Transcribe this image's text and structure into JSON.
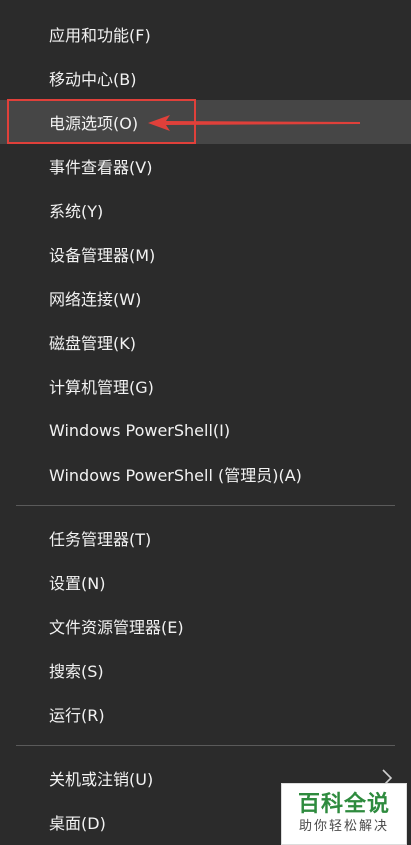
{
  "menu": {
    "group1": [
      {
        "label": "应用和功能(F)"
      },
      {
        "label": "移动中心(B)"
      },
      {
        "label": "电源选项(O)"
      },
      {
        "label": "事件查看器(V)"
      },
      {
        "label": "系统(Y)"
      },
      {
        "label": "设备管理器(M)"
      },
      {
        "label": "网络连接(W)"
      },
      {
        "label": "磁盘管理(K)"
      },
      {
        "label": "计算机管理(G)"
      },
      {
        "label": "Windows PowerShell(I)"
      },
      {
        "label": "Windows PowerShell (管理员)(A)"
      }
    ],
    "group2": [
      {
        "label": "任务管理器(T)"
      },
      {
        "label": "设置(N)"
      },
      {
        "label": "文件资源管理器(E)"
      },
      {
        "label": "搜索(S)"
      },
      {
        "label": "运行(R)"
      }
    ],
    "group3": [
      {
        "label": "关机或注销(U)"
      },
      {
        "label": "桌面(D)"
      }
    ],
    "highlighted_item": "电源选项(O)"
  },
  "watermark": {
    "title": "百科全说",
    "subtitle": "助你轻松解决"
  },
  "colors": {
    "background": "#2b2b2b",
    "highlight_bg": "#464646",
    "annotation": "#e0403a",
    "watermark_green": "#2e8b3e"
  },
  "icons": [
    "chevron-right-icon",
    "red-arrow-annotation"
  ]
}
